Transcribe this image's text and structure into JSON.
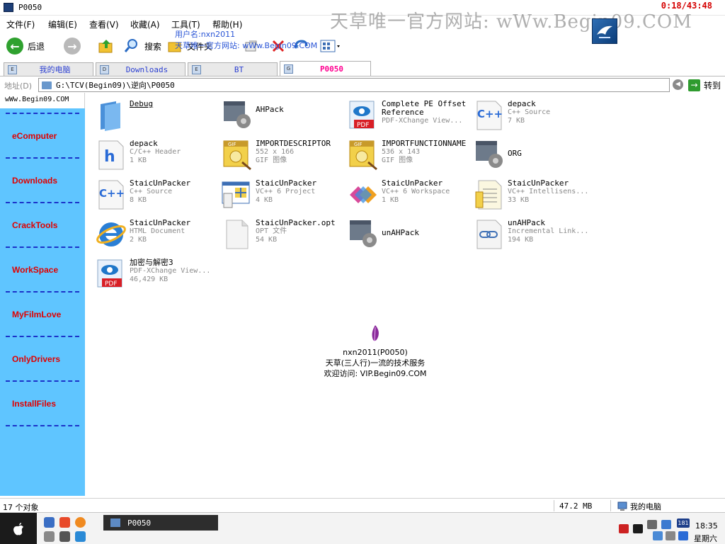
{
  "window": {
    "title": "P0050",
    "timer": "0:18/43:48"
  },
  "watermark": {
    "text": "天草唯一官方网站: wWw.Begin09.COM"
  },
  "overlay": {
    "user": "用户名:nxn2011",
    "site": "天草唯一官方网站: wWw.Begin09.COM",
    "center_line1": "nxn2011(P0050)",
    "center_line2": "天草(三人行)一流的技术服务",
    "center_line3": "欢迎访问: VIP.Begin09.COM"
  },
  "menu": {
    "file": "文件(F)",
    "edit": "编辑(E)",
    "view": "查看(V)",
    "favorites": "收藏(A)",
    "tools": "工具(T)",
    "help": "帮助(H)"
  },
  "toolbar": {
    "back": "后退",
    "search": "搜索",
    "folders": "文件夹"
  },
  "tabs": [
    {
      "label": "我的电脑",
      "icon": "E",
      "active": false
    },
    {
      "label": "Downloads",
      "icon": "D",
      "active": false
    },
    {
      "label": "BT",
      "icon": "E",
      "active": false
    },
    {
      "label": "P0050",
      "icon": "G",
      "active": true
    }
  ],
  "address": {
    "label": "地址(D)",
    "path": "G:\\TCV(Begin09)\\逆向\\P0050",
    "go": "转到"
  },
  "sidebar": {
    "header": "wWw.Begin09.COM",
    "items": [
      "eComputer",
      "Downloads",
      "CrackTools",
      "WorkSpace",
      "MyFilmLove",
      "OnlyDrivers",
      "InstallFiles"
    ],
    "bg_color": "#5fc5ff",
    "text_color": "#e00000"
  },
  "files": [
    {
      "name": "Debug",
      "line2": "",
      "line3": "",
      "icon": "folder-icon"
    },
    {
      "name": "AHPack",
      "line2": "",
      "line3": "",
      "icon": "exe-icon"
    },
    {
      "name": "Complete PE Offset",
      "line2": "Reference",
      "line3": "PDF-XChange View...",
      "icon": "pdf-icon"
    },
    {
      "name": "depack",
      "line2": "C++ Source",
      "line3": "7 KB",
      "icon": "cpp-icon"
    },
    {
      "name": "depack",
      "line2": "C/C++ Header",
      "line3": "1 KB",
      "icon": "header-icon"
    },
    {
      "name": "IMPORTDESCRIPTOR",
      "line2": "552 x 166",
      "line3": "GIF 图像",
      "icon": "gif-icon"
    },
    {
      "name": "IMPORTFUNCTIONNAME",
      "line2": "536 x 143",
      "line3": "GIF 图像",
      "icon": "gif-icon"
    },
    {
      "name": "ORG",
      "line2": "",
      "line3": "",
      "icon": "exe-icon"
    },
    {
      "name": "StaicUnPacker",
      "line2": "C++ Source",
      "line3": "8 KB",
      "icon": "cpp-icon"
    },
    {
      "name": "StaicUnPacker",
      "line2": "VC++ 6 Project",
      "line3": "4 KB",
      "icon": "project-icon"
    },
    {
      "name": "StaicUnPacker",
      "line2": "VC++ 6 Workspace",
      "line3": "1 KB",
      "icon": "workspace-icon"
    },
    {
      "name": "StaicUnPacker",
      "line2": "VC++ Intellisens...",
      "line3": "33 KB",
      "icon": "intellisense-icon"
    },
    {
      "name": "StaicUnPacker",
      "line2": "HTML Document",
      "line3": "2 KB",
      "icon": "ie-icon"
    },
    {
      "name": "StaicUnPacker.opt",
      "line2": "OPT 文件",
      "line3": "54 KB",
      "icon": "blank-file-icon"
    },
    {
      "name": "unAHPack",
      "line2": "",
      "line3": "",
      "icon": "exe-icon"
    },
    {
      "name": "unAHPack",
      "line2": "Incremental Link...",
      "line3": "194 KB",
      "icon": "link-icon"
    },
    {
      "name": "加密与解密3",
      "line2": "PDF-XChange View...",
      "line3": "46,429 KB",
      "icon": "pdf-icon"
    }
  ],
  "status": {
    "count": "17 个对象",
    "size": "47.2 MB",
    "location": "我的电脑"
  },
  "taskbar": {
    "task": "P0050",
    "clock": "18:35",
    "day": "星期六",
    "badge": "181"
  }
}
